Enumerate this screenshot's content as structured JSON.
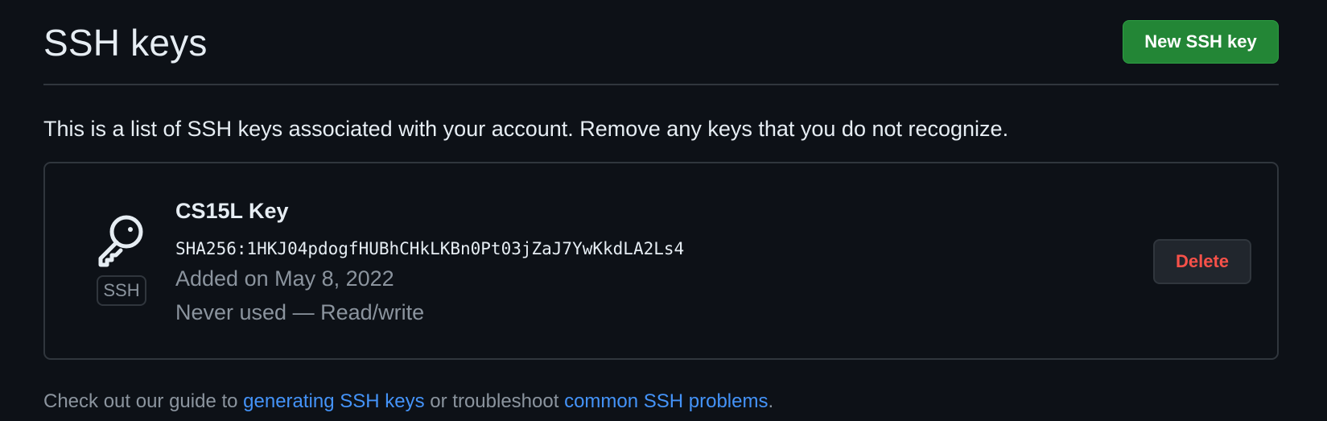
{
  "header": {
    "title": "SSH keys",
    "new_key_label": "New SSH key"
  },
  "intro_text": "This is a list of SSH keys associated with your account. Remove any keys that you do not recognize.",
  "keys": [
    {
      "title": "CS15L Key",
      "fingerprint": "SHA256:1HKJ04pdogfHUBhCHkLKBn0Pt03jZaJ7YwKkdLA2Ls4",
      "added": "Added on May 8, 2022",
      "usage": "Never used — Read/write",
      "badge": "SSH",
      "icon": "key-icon",
      "delete_label": "Delete"
    }
  ],
  "footer": {
    "prefix": "Check out our guide to ",
    "link1": "generating SSH keys",
    "middle": " or troubleshoot ",
    "link2": "common SSH problems",
    "suffix": "."
  },
  "colors": {
    "background": "#0d1117",
    "border": "#30363d",
    "primary_button": "#238636",
    "danger_text": "#f85149",
    "link": "#4493f8",
    "muted_text": "#8b949e"
  }
}
